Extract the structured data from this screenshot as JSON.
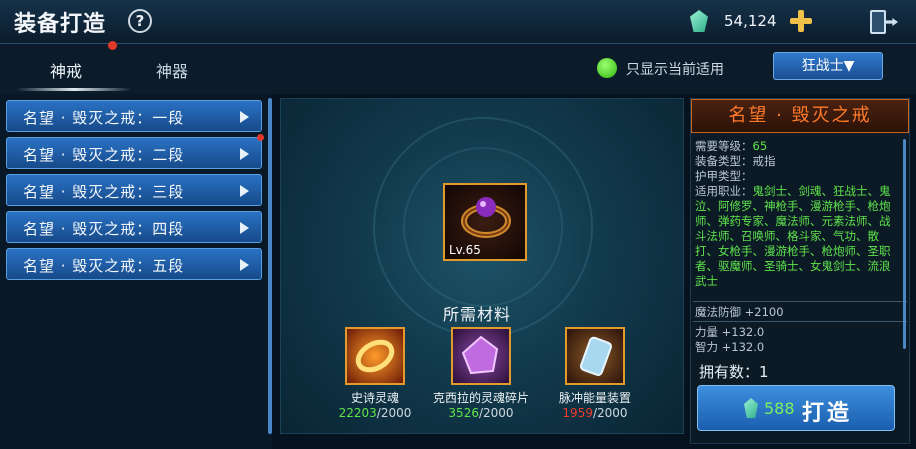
{
  "header": {
    "title": "装备打造",
    "help_symbol": "?",
    "currency_value": "54,124"
  },
  "tabs": [
    {
      "label": "神戒",
      "active": true
    },
    {
      "label": "神器",
      "active": false
    }
  ],
  "filter": {
    "toggle_label": "只显示当前适用",
    "class_select": "狂战士▼"
  },
  "recipes": [
    {
      "label": "名望 · 毁灭之戒：一段"
    },
    {
      "label": "名望 · 毁灭之戒：二段"
    },
    {
      "label": "名望 · 毁灭之戒：三段"
    },
    {
      "label": "名望 · 毁灭之戒：四段"
    },
    {
      "label": "名望 · 毁灭之戒：五段"
    }
  ],
  "item": {
    "level_label": "Lv.65",
    "name": "名望 · 毁灭之戒",
    "req_level_label": "需要等级：",
    "req_level_value": "65",
    "equip_type": "装备类型：戒指",
    "armor_type": "护甲类型：",
    "jobs_label": "适用职业：",
    "jobs_value": "鬼剑士、剑魂、狂战士、鬼泣、阿修罗、神枪手、漫游枪手、枪炮师、弹药专家、魔法师、元素法师、战斗法师、召唤师、格斗家、气功、散打、女枪手、漫游枪手、枪炮师、圣职者、驱魔师、圣骑士、女鬼剑士、流浪武士",
    "magic_def": "魔法防御 +2100",
    "strength": "力量 +132.0",
    "intelligence": "智力 +132.0",
    "owned": "拥有数：1"
  },
  "materials": {
    "title": "所需材料",
    "items": [
      {
        "name": "史诗灵魂",
        "have": "22203",
        "need": "/2000",
        "status": "enough"
      },
      {
        "name": "克西拉的灵魂碎片",
        "have": "3526",
        "need": "/2000",
        "status": "enough"
      },
      {
        "name": "脉冲能量装置",
        "have": "1959",
        "need": "/2000",
        "status": "lacking"
      }
    ]
  },
  "craft": {
    "cost": "588",
    "label": "打造"
  },
  "colors": {
    "accent_blue": "#2a72c4",
    "gold_frame": "#e39a2c",
    "item_name_orange": "#ff7a2a",
    "enough_green": "#5ee34b",
    "lacking_red": "#ef3c2e"
  }
}
